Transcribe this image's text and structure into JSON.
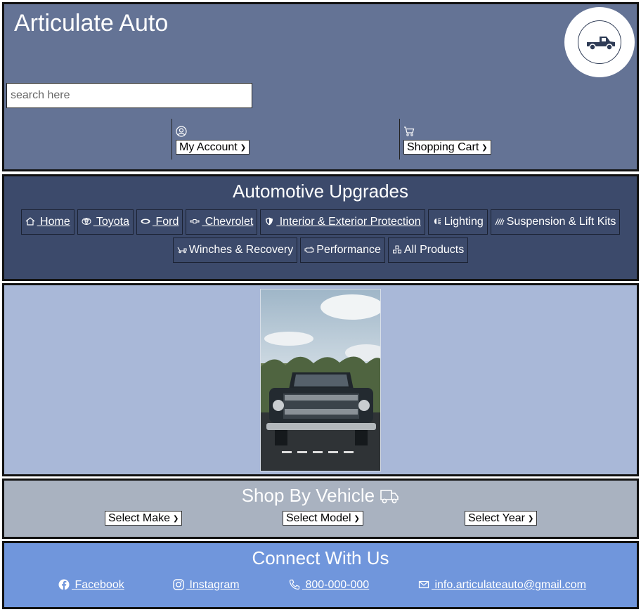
{
  "header": {
    "site_title": "Articulate Auto",
    "logo_icon": "pickup-truck-icon",
    "search": {
      "placeholder": "search here",
      "value": ""
    },
    "account": {
      "icon": "user-circle-icon",
      "label": "My Account"
    },
    "cart": {
      "icon": "cart-icon",
      "label": "Shopping Cart"
    }
  },
  "nav": {
    "title": "Automotive Upgrades",
    "items": [
      {
        "label": " Home",
        "icon": "home-icon"
      },
      {
        "label": " Toyota",
        "icon": "toyota-logo-icon"
      },
      {
        "label": " Ford",
        "icon": "ford-logo-icon"
      },
      {
        "label": " Chevrolet",
        "icon": "chevrolet-logo-icon"
      },
      {
        "label": " Interior & Exterior Protection",
        "icon": "shield-icon"
      },
      {
        "label": "Lighting",
        "icon": "headlight-icon"
      },
      {
        "label": "Suspension & Lift Kits",
        "icon": "spring-icon"
      },
      {
        "label": "Winches & Recovery",
        "icon": "tow-truck-icon"
      },
      {
        "label": "Performance",
        "icon": "engine-icon"
      },
      {
        "label": "All Products",
        "icon": "boxes-icon"
      }
    ]
  },
  "hero": {
    "image_icon": "gmc-truck-photo"
  },
  "shop": {
    "title": "Shop By Vehicle",
    "title_icon": "truck-icon",
    "make": "Select Make",
    "model": "Select Model",
    "year": "Select Year"
  },
  "connect": {
    "title": "Connect With Us",
    "facebook": " Facebook",
    "instagram": " Instagram",
    "phone": " 800-000-000",
    "email": " info.articulateauto@gmail.com"
  },
  "colors": {
    "header_bg": "#647395",
    "nav_bg": "#3c4a6b",
    "hero_bg": "#a9b8d8",
    "shop_bg": "#a9b2c0",
    "connect_bg": "#7096dc"
  }
}
